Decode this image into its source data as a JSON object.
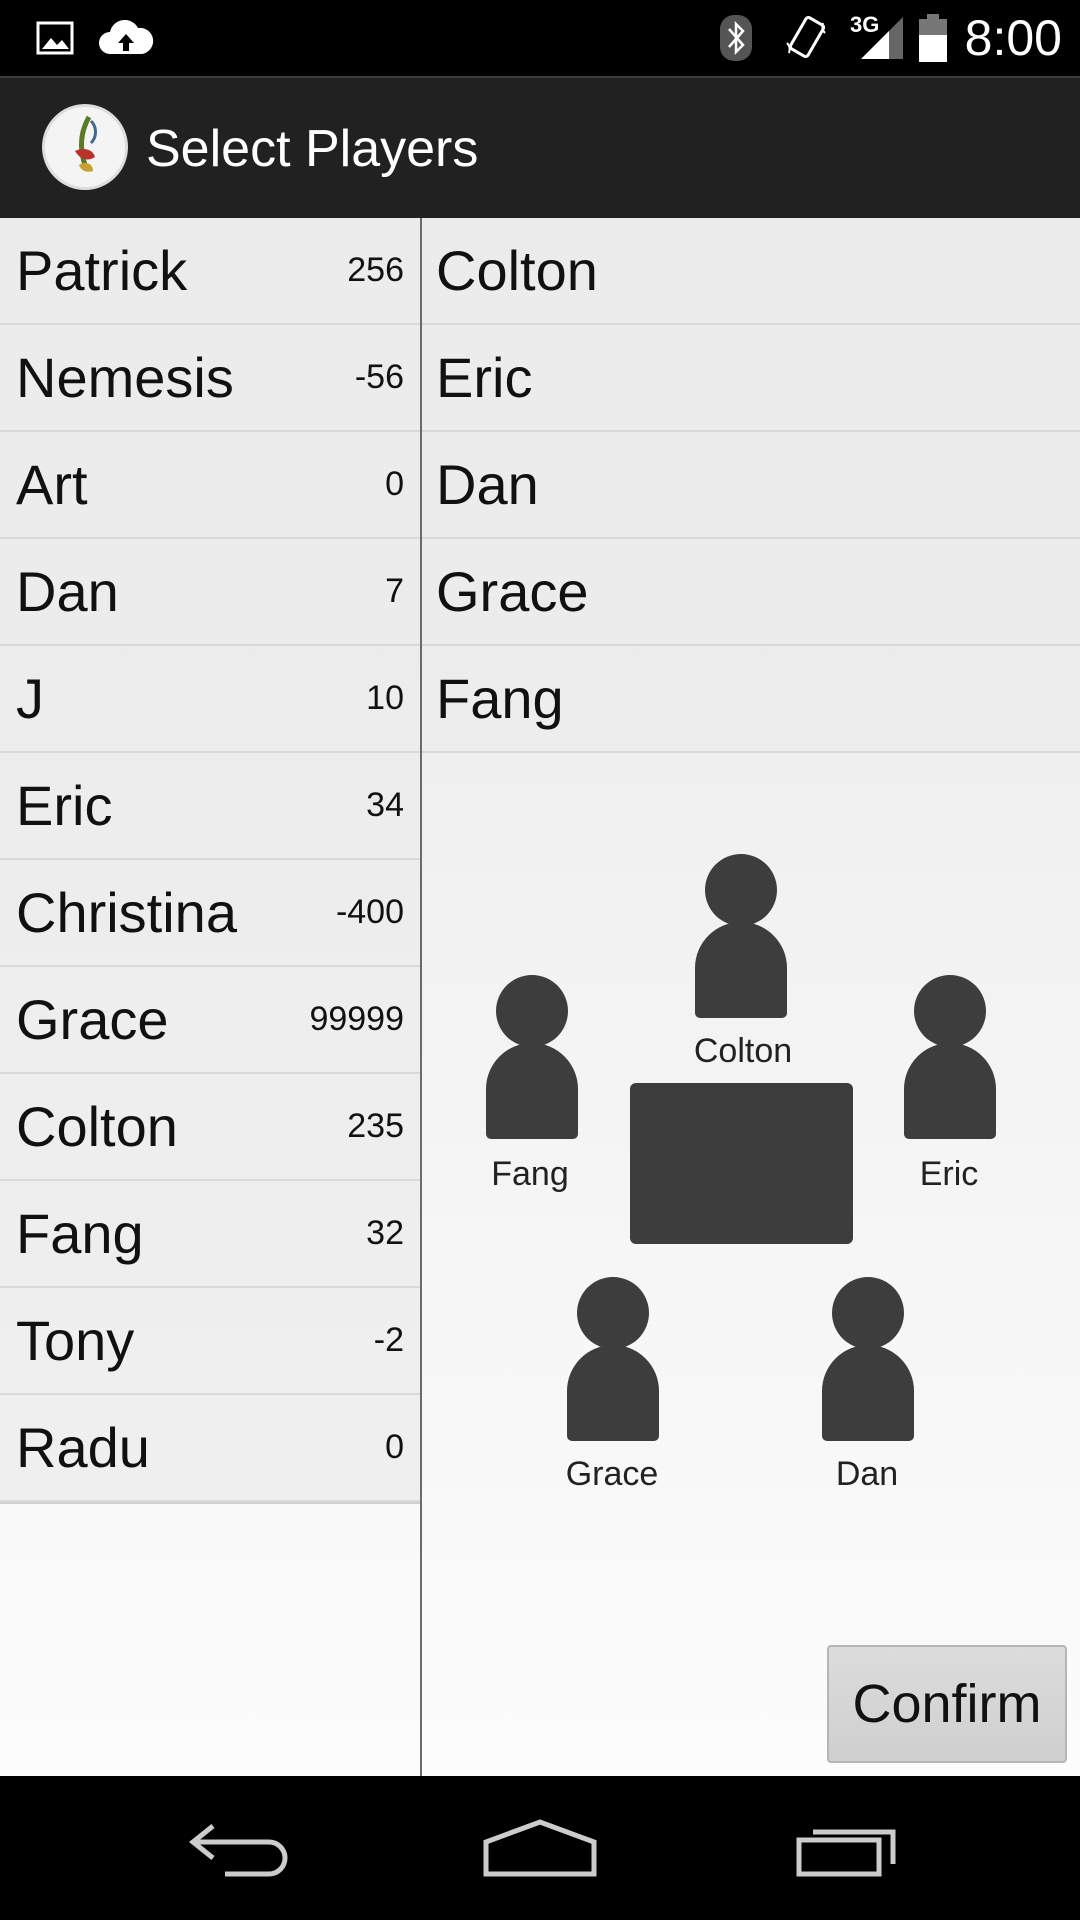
{
  "status_bar": {
    "time": "8:00",
    "network": "3G",
    "icons": [
      "image-icon",
      "cloud-upload-icon",
      "bluetooth-icon",
      "vibrate-icon",
      "signal-icon",
      "battery-icon"
    ]
  },
  "action_bar": {
    "title": "Select Players",
    "logo": "app-logo-icon"
  },
  "all_players": [
    {
      "name": "Patrick",
      "score": "256"
    },
    {
      "name": "Nemesis",
      "score": "-56"
    },
    {
      "name": "Art",
      "score": "0"
    },
    {
      "name": "Dan",
      "score": "7"
    },
    {
      "name": "J",
      "score": "10"
    },
    {
      "name": "Eric",
      "score": "34"
    },
    {
      "name": "Christina",
      "score": "-400"
    },
    {
      "name": "Grace",
      "score": "99999"
    },
    {
      "name": "Colton",
      "score": "235"
    },
    {
      "name": "Fang",
      "score": "32"
    },
    {
      "name": "Tony",
      "score": "-2"
    },
    {
      "name": "Radu",
      "score": "0"
    }
  ],
  "selected_players": [
    "Colton",
    "Eric",
    "Dan",
    "Grace",
    "Fang"
  ],
  "seating": {
    "top": "Colton",
    "left": "Fang",
    "right": "Eric",
    "bottom_left": "Grace",
    "bottom_right": "Dan"
  },
  "confirm_label": "Confirm",
  "nav_bar": {
    "icons": [
      "back-icon",
      "home-icon",
      "recents-icon"
    ]
  },
  "colors": {
    "status_bar": "#000000",
    "action_bar": "#212121",
    "figure": "#3d3d3d"
  }
}
